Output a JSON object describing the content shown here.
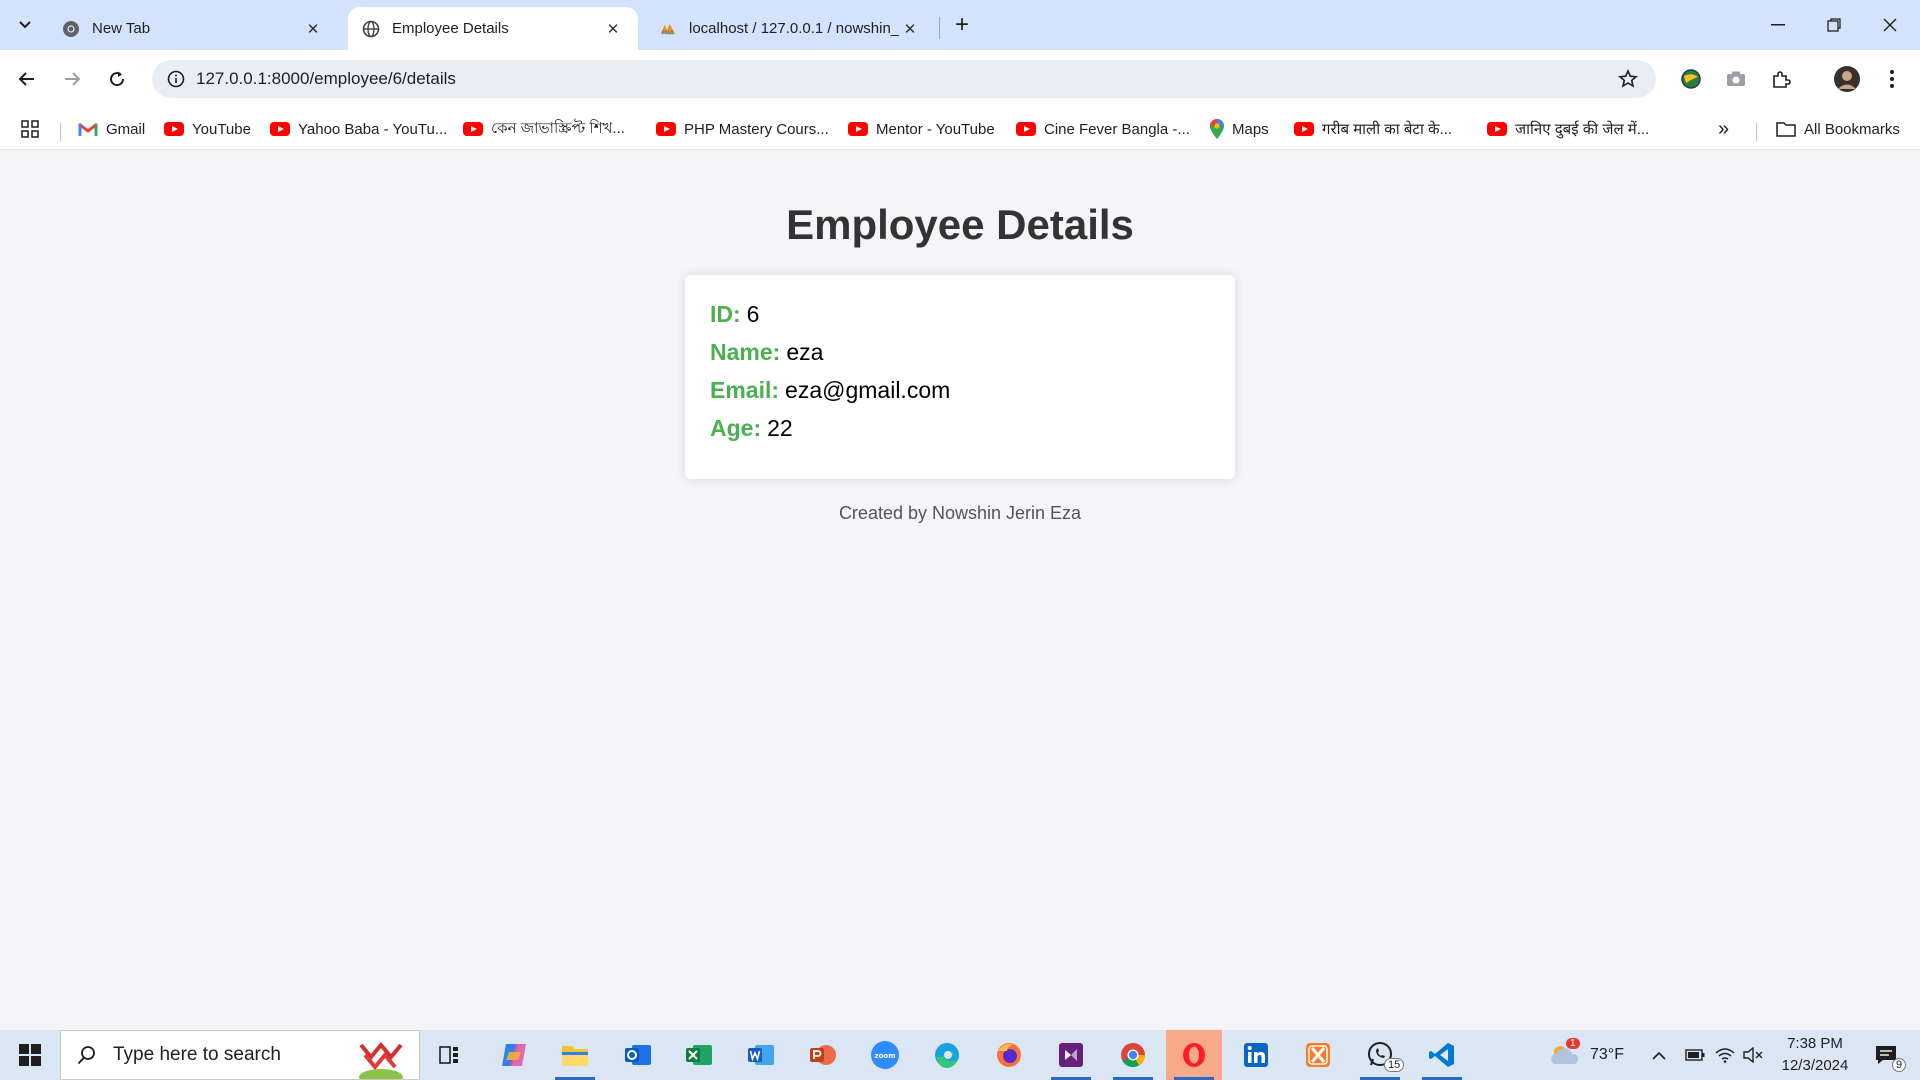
{
  "browser": {
    "tabs": [
      {
        "title": "New Tab",
        "icon": "chrome-icon",
        "active": false
      },
      {
        "title": "Employee Details",
        "icon": "globe-icon",
        "active": true
      },
      {
        "title": "localhost / 127.0.0.1 / nowshin_",
        "icon": "phpmyadmin-icon",
        "active": false
      }
    ],
    "url": "127.0.0.1:8000/employee/6/details",
    "bookmarks": [
      {
        "label": "Gmail",
        "icon": "gmail-icon"
      },
      {
        "label": "YouTube",
        "icon": "youtube-icon"
      },
      {
        "label": "Yahoo Baba - YouTu...",
        "icon": "youtube-icon"
      },
      {
        "label": "কেন জাভাস্ক্রিপ্ট শিখ...",
        "icon": "youtube-icon"
      },
      {
        "label": "PHP Mastery Cours...",
        "icon": "youtube-icon"
      },
      {
        "label": "Mentor - YouTube",
        "icon": "youtube-icon"
      },
      {
        "label": "Cine Fever Bangla -...",
        "icon": "youtube-icon"
      },
      {
        "label": "Maps",
        "icon": "maps-pin-icon"
      },
      {
        "label": "गरीब माली का बेटा के...",
        "icon": "youtube-icon"
      },
      {
        "label": "जानिए दुबई की जेल में...",
        "icon": "youtube-icon"
      }
    ],
    "all_bookmarks_label": "All Bookmarks",
    "overflow_label": "»"
  },
  "page": {
    "title": "Employee Details",
    "fields": [
      {
        "label": "ID:",
        "value": "6"
      },
      {
        "label": "Name:",
        "value": "eza"
      },
      {
        "label": "Email:",
        "value": "eza@gmail.com"
      },
      {
        "label": "Age:",
        "value": "22"
      }
    ],
    "footer": "Created by Nowshin Jerin Eza",
    "colors": {
      "label": "#4caf50",
      "background": "#f4f4f9",
      "title": "#333333"
    }
  },
  "taskbar": {
    "search_placeholder": "Type here to search",
    "weather": "73°F",
    "weather_badge": "1",
    "time": "7:38 PM",
    "date": "12/3/2024",
    "whatsapp_badge": "15",
    "notifications_badge": "9"
  }
}
